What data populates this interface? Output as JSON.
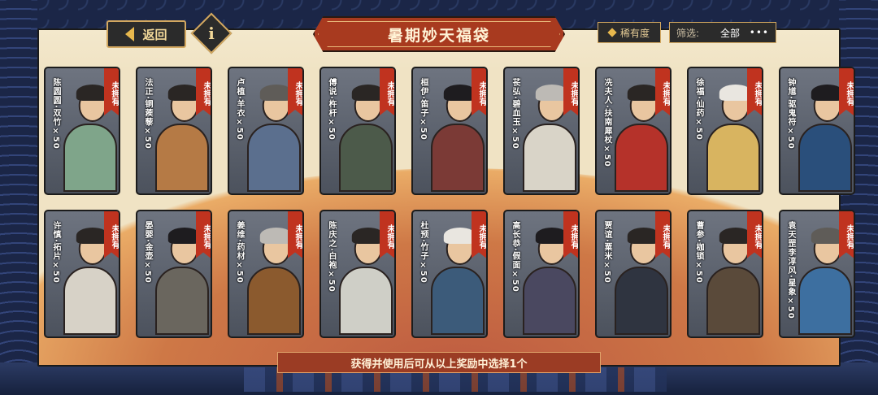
{
  "header": {
    "back_label": "返回",
    "info_label": "i",
    "title": "暑期妙天福袋",
    "rarity_label": "稀有度",
    "filter_label": "筛选:",
    "filter_value": "全部",
    "more_label": "•••"
  },
  "tag_label": "未拥有",
  "cards_row1": [
    {
      "name": "陈圆圆·双竹×50",
      "robe": "#7fa58a"
    },
    {
      "name": "法正·铜蒺藜×50",
      "robe": "#b57a45"
    },
    {
      "name": "卢植·羊衣×50",
      "robe": "#5b6f8e"
    },
    {
      "name": "傅说·杵杆×50",
      "robe": "#4c5a4a"
    },
    {
      "name": "桓伊·笛子×50",
      "robe": "#7b3a36"
    },
    {
      "name": "苌弘·碧血玉×50",
      "robe": "#d9d4c8"
    },
    {
      "name": "冼夫人·扶南犀杖×50",
      "robe": "#b5322a"
    },
    {
      "name": "徐福·仙药×50",
      "robe": "#d8b460"
    },
    {
      "name": "钟馗·驱鬼符×50",
      "robe": "#2a4f7b"
    }
  ],
  "cards_row2": [
    {
      "name": "许慎·拓片×50",
      "robe": "#d7d2c7"
    },
    {
      "name": "晏婴·金壶×50",
      "robe": "#6a665e"
    },
    {
      "name": "姜维·药材×50",
      "robe": "#8b5a2e"
    },
    {
      "name": "陈庆之·白袍×50",
      "robe": "#cfcfc7"
    },
    {
      "name": "杜预·竹子×50",
      "robe": "#3c5b7a"
    },
    {
      "name": "高长恭·假面×50",
      "robe": "#4a4860"
    },
    {
      "name": "贾谊·粟米×50",
      "robe": "#2f3440"
    },
    {
      "name": "曹参·枷锁×50",
      "robe": "#5a4a3a"
    },
    {
      "name": "袁天罡李淳风·星象×50",
      "robe": "#3d6fa0"
    }
  ],
  "footer_note": "获得并使用后可从以上奖励中选择1个"
}
